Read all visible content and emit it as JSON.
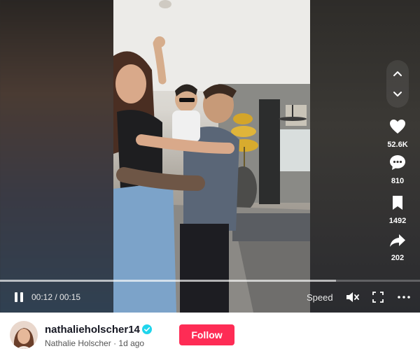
{
  "video": {
    "current_time": "00:12",
    "duration": "00:15",
    "progress": 0.8,
    "speed_label": "Speed"
  },
  "actions": {
    "likes": "52.6K",
    "comments": "810",
    "saves": "1492",
    "shares": "202"
  },
  "author": {
    "username": "nathalieholscher14",
    "display_name": "Nathalie Holscher",
    "posted": "1d ago",
    "verified": true
  },
  "follow_label": "Follow",
  "colors": {
    "follow": "#fe2c55",
    "verified": "#20d5ec"
  },
  "icons": [
    "chevron-up-icon",
    "chevron-down-icon",
    "heart-icon",
    "comment-icon",
    "bookmark-icon",
    "share-icon",
    "pause-icon",
    "mute-icon",
    "fullscreen-icon",
    "more-icon"
  ]
}
